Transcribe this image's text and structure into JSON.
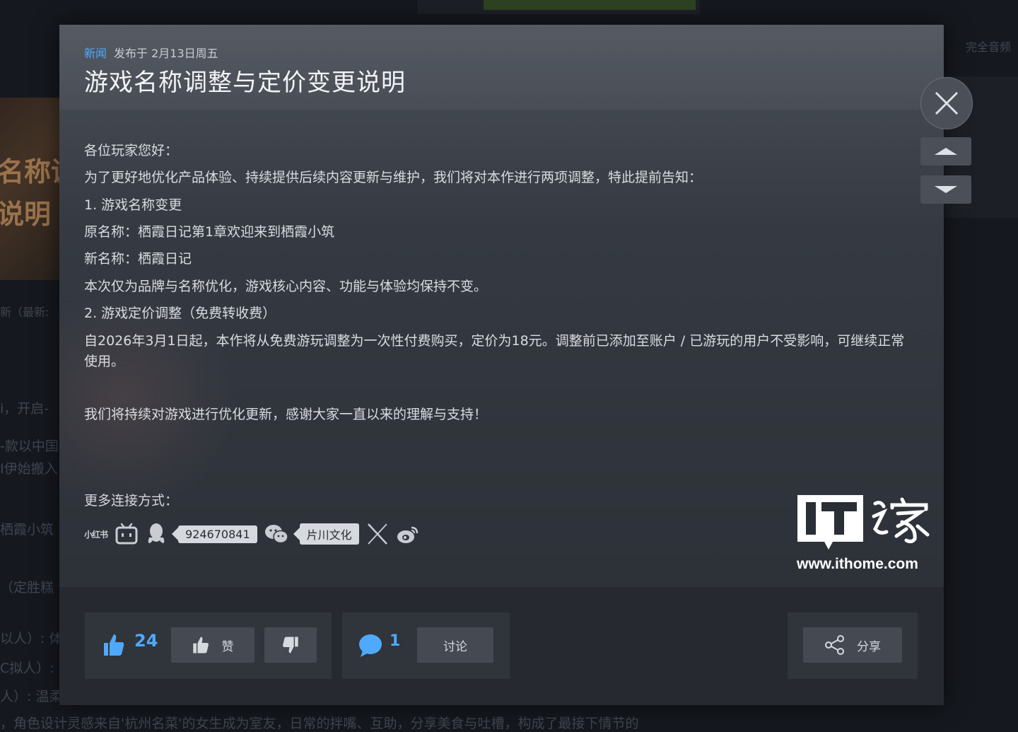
{
  "background": {
    "thumb_text_1": "名称调",
    "thumb_text_2": "说明",
    "right_text": "完全音频",
    "line_1": "新（最新:",
    "line_2": "i，开启-",
    "line_3": "-款以中国",
    "line_4": "I伊始搬入",
    "line_5": "栖霞小筑",
    "line_6": "\t（定胜糕",
    "line_7": "以人）: 体",
    "line_8": "C拟人）: 三",
    "line_9": "人）: 温柔",
    "line_10": "，角色设计灵感来自'杭州名菜'的女生成为室友，日常的拌嘴、互助，分享美食与吐槽，构成了最接下情节的"
  },
  "modal": {
    "tag": "新闻",
    "published": "发布于 2月13日周五",
    "title": "游戏名称调整与定价变更说明",
    "body": [
      "各位玩家您好：",
      "为了更好地优化产品体验、持续提供后续内容更新与维护，我们将对本作进行两项调整，特此提前告知：",
      "1. 游戏名称变更",
      "原名称：栖霞日记第1章欢迎来到栖霞小筑",
      "新名称：栖霞日记",
      "本次仅为品牌与名称优化，游戏核心内容、功能与体验均保持不变。",
      "2. 游戏定价调整（免费转收费）",
      "自2026年3月1日起，本作将从免费游玩调整为一次性付费购买，定价为18元。调整前已添加至账户 / 已游玩的用户不受影响，可继续正常使用。",
      "我们将持续对游戏进行优化更新，感谢大家一直以来的理解与支持！"
    ],
    "contact_label": "更多连接方式：",
    "social": {
      "xiaohongshu": "小红书",
      "qq_group": "924670841",
      "wechat": "片川文化"
    },
    "footer": {
      "like_count": "24",
      "like_label": "赞",
      "comment_count": "1",
      "discuss_label": "讨论",
      "share_label": "分享"
    }
  },
  "watermark": {
    "logo": "IT之家",
    "url": "www.ithome.com"
  },
  "colors": {
    "accent": "#4fa9ff",
    "modal_bg": "#353a42",
    "footer_bg": "#262a30"
  }
}
